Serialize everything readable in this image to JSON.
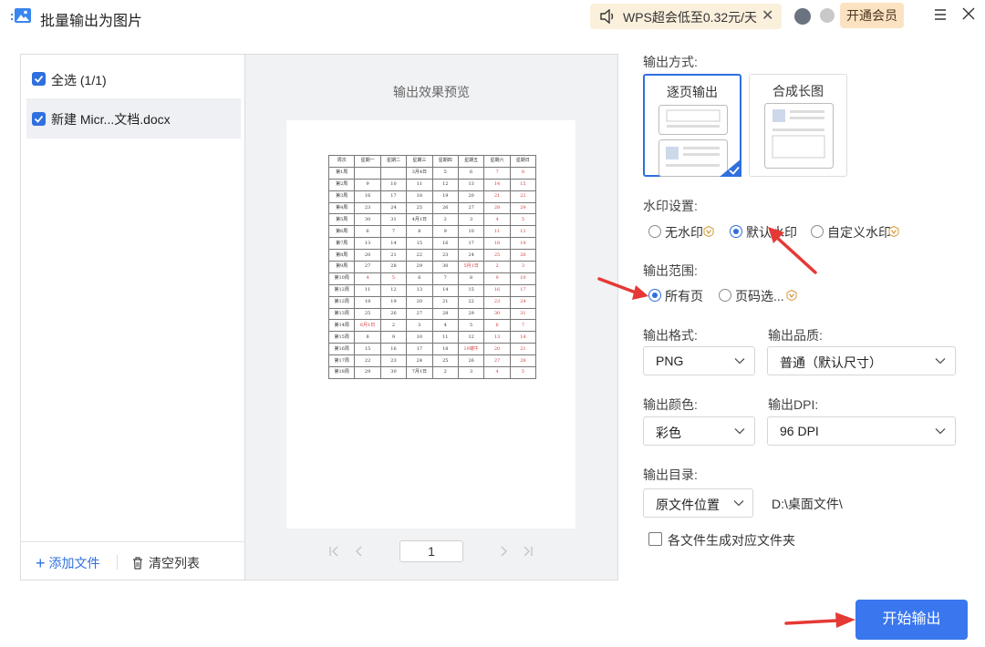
{
  "window": {
    "title": "批量输出为图片",
    "promo_text": "WPS超会低至0.32元/天",
    "vip_button": "开通会员"
  },
  "file_list": {
    "select_all_label": "全选 (1/1)",
    "files": [
      {
        "name": "新建 Micr...文档.docx",
        "checked": true
      }
    ],
    "add_file_label": "添加文件",
    "clear_list_label": "清空列表"
  },
  "preview": {
    "title": "输出效果预览",
    "page_number": "1",
    "calendar": {
      "header": [
        "周次",
        "星期一",
        "星期二",
        "星期三",
        "星期四",
        "星期五",
        "星期六",
        "星期日"
      ],
      "rows": [
        [
          "第1周",
          "",
          "",
          "3月4日",
          "5",
          "6",
          "7",
          "8"
        ],
        [
          "第2周",
          "9",
          "10",
          "11",
          "12",
          "13",
          "14",
          "15"
        ],
        [
          "第3周",
          "16",
          "17",
          "18",
          "19",
          "20",
          "21",
          "22"
        ],
        [
          "第4周",
          "23",
          "24",
          "25",
          "26",
          "27",
          "28",
          "29"
        ],
        [
          "第5周",
          "30",
          "31",
          "4月1日",
          "2",
          "3",
          "4",
          "5"
        ],
        [
          "第6周",
          "6",
          "7",
          "8",
          "9",
          "10",
          "11",
          "12"
        ],
        [
          "第7周",
          "13",
          "14",
          "15",
          "16",
          "17",
          "18",
          "19"
        ],
        [
          "第8周",
          "20",
          "21",
          "22",
          "23",
          "24",
          "25",
          "26"
        ],
        [
          "第9周",
          "27",
          "28",
          "29",
          "30",
          "5月1日",
          "2",
          "3"
        ],
        [
          "第10周",
          "4",
          "5",
          "6",
          "7",
          "8",
          "9",
          "10"
        ],
        [
          "第12周",
          "11",
          "12",
          "13",
          "14",
          "15",
          "16",
          "17"
        ],
        [
          "第12周",
          "18",
          "19",
          "20",
          "21",
          "22",
          "23",
          "24"
        ],
        [
          "第13周",
          "25",
          "26",
          "27",
          "28",
          "29",
          "30",
          "31"
        ],
        [
          "第14周",
          "6月1日",
          "2",
          "3",
          "4",
          "5",
          "6",
          "7"
        ],
        [
          "第15周",
          "8",
          "9",
          "10",
          "11",
          "12",
          "13",
          "14"
        ],
        [
          "第16周",
          "15",
          "16",
          "17",
          "18",
          "19端午",
          "20",
          "21"
        ],
        [
          "第17周",
          "22",
          "23",
          "24",
          "25",
          "26",
          "27",
          "28"
        ],
        [
          "第18周",
          "29",
          "30",
          "7月1日",
          "2",
          "3",
          "4",
          "5"
        ]
      ],
      "red_cells": [
        [
          0,
          6
        ],
        [
          0,
          7
        ],
        [
          1,
          6
        ],
        [
          1,
          7
        ],
        [
          2,
          6
        ],
        [
          2,
          7
        ],
        [
          3,
          6
        ],
        [
          3,
          7
        ],
        [
          4,
          6
        ],
        [
          4,
          7
        ],
        [
          5,
          6
        ],
        [
          5,
          7
        ],
        [
          6,
          6
        ],
        [
          6,
          7
        ],
        [
          7,
          6
        ],
        [
          7,
          7
        ],
        [
          8,
          5
        ],
        [
          8,
          6
        ],
        [
          8,
          7
        ],
        [
          9,
          1
        ],
        [
          9,
          2
        ],
        [
          9,
          6
        ],
        [
          9,
          7
        ],
        [
          10,
          6
        ],
        [
          10,
          7
        ],
        [
          11,
          6
        ],
        [
          11,
          7
        ],
        [
          12,
          6
        ],
        [
          12,
          7
        ],
        [
          13,
          1
        ],
        [
          13,
          6
        ],
        [
          13,
          7
        ],
        [
          14,
          6
        ],
        [
          14,
          7
        ],
        [
          15,
          5
        ],
        [
          15,
          6
        ],
        [
          15,
          7
        ],
        [
          16,
          6
        ],
        [
          16,
          7
        ],
        [
          17,
          6
        ],
        [
          17,
          7
        ]
      ]
    }
  },
  "settings": {
    "output_mode": {
      "label": "输出方式:",
      "options": [
        "逐页输出",
        "合成长图"
      ],
      "selected": 0
    },
    "watermark": {
      "label": "水印设置:",
      "options": [
        "无水印",
        "默认水印",
        "自定义水印"
      ],
      "selected": 1
    },
    "range": {
      "label": "输出范围:",
      "options": [
        "所有页",
        "页码选..."
      ],
      "selected": 0
    },
    "format": {
      "label": "输出格式:",
      "value": "PNG"
    },
    "quality": {
      "label": "输出品质:",
      "value": "普通（默认尺寸）"
    },
    "color": {
      "label": "输出颜色:",
      "value": "彩色"
    },
    "dpi": {
      "label": "输出DPI:",
      "value": "96 DPI"
    },
    "directory": {
      "label": "输出目录:",
      "value": "原文件位置",
      "path": "D:\\桌面文件\\"
    },
    "per_file_folder": {
      "label": "各文件生成对应文件夹",
      "checked": false
    }
  },
  "start_button": "开始输出",
  "colors": {
    "accent": "#2f6fde",
    "button": "#3a77ee",
    "annotation_arrow": "#e53935",
    "vip_badge": "#d49a3a"
  }
}
